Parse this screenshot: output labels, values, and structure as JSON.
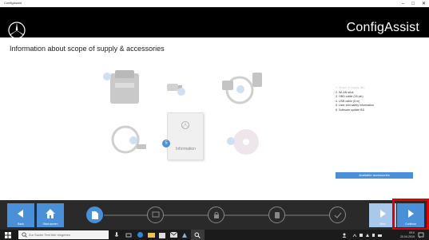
{
  "window": {
    "title": "ConfigAssist",
    "min_glyph": "–",
    "max_glyph": "□",
    "close_glyph": "✕"
  },
  "header": {
    "app_title": "ConfigAssist"
  },
  "content": {
    "page_title": "Information about scope of supply & accessories",
    "info_card_label": "Information",
    "active_step_number": "5",
    "list_items": [
      "1. Scope of supply (kit)",
      "2. WLAN stick",
      "3. OBD cable (16 pin)",
      "4. USB cable (5 m)",
      "5. User and safety information",
      "6. Software update BD"
    ],
    "accessories_button": "Available accessories"
  },
  "nav": {
    "back": "Back",
    "start_screen": "Start screen",
    "next": "Next",
    "continue": "Continue"
  },
  "taskbar": {
    "search_placeholder": "Zur Suche Text hier eingeben",
    "time": "09:0",
    "date": "20.04.2019"
  },
  "colors": {
    "accent": "#4a90d9",
    "highlight_box": "#e00000"
  }
}
